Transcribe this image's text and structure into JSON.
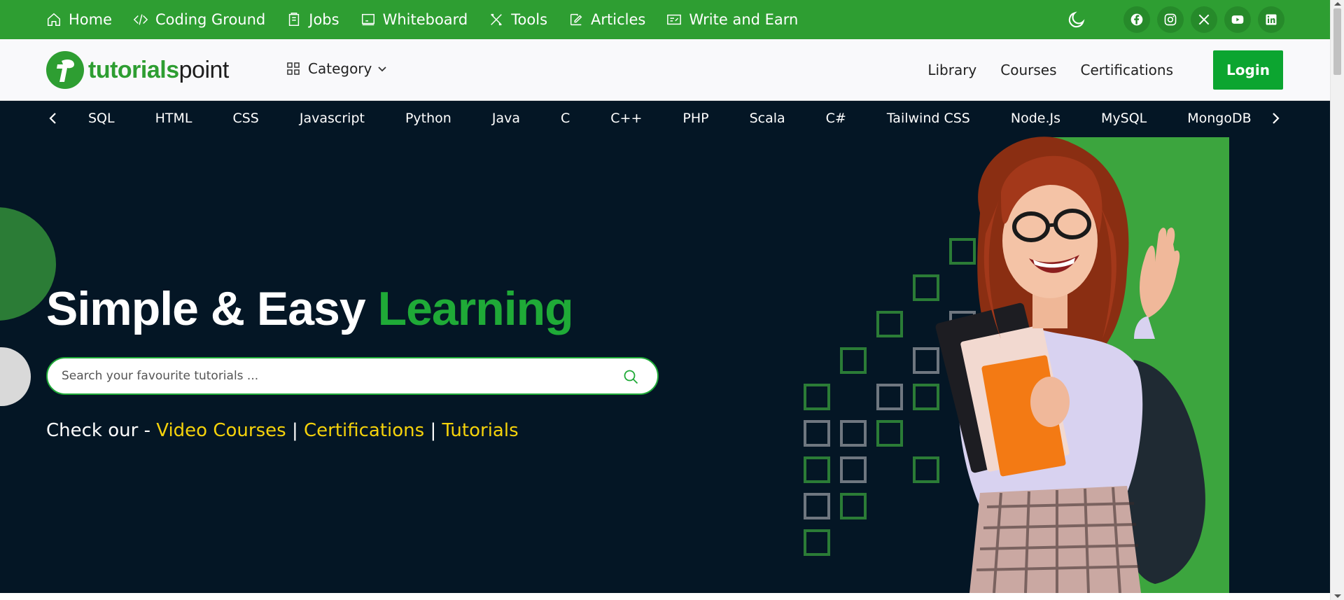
{
  "topnav": {
    "items": [
      {
        "label": "Home",
        "icon": "home-icon"
      },
      {
        "label": "Coding Ground",
        "icon": "code-icon"
      },
      {
        "label": "Jobs",
        "icon": "briefcase-icon"
      },
      {
        "label": "Whiteboard",
        "icon": "whiteboard-icon"
      },
      {
        "label": "Tools",
        "icon": "tools-icon"
      },
      {
        "label": "Articles",
        "icon": "edit-icon"
      },
      {
        "label": "Write and Earn",
        "icon": "write-earn-icon"
      }
    ],
    "socials": [
      "facebook-icon",
      "instagram-icon",
      "x-icon",
      "youtube-icon",
      "linkedin-icon"
    ]
  },
  "header": {
    "logo_part1": "tutorials",
    "logo_part2": "point",
    "category_label": "Category",
    "links": [
      "Library",
      "Courses",
      "Certifications"
    ],
    "login_label": "Login"
  },
  "techbar": {
    "items": [
      "SQL",
      "HTML",
      "CSS",
      "Javascript",
      "Python",
      "Java",
      "C",
      "C++",
      "PHP",
      "Scala",
      "C#",
      "Tailwind CSS",
      "Node.Js",
      "MySQL",
      "MongoDB"
    ]
  },
  "hero": {
    "title_white": "Simple & Easy",
    "title_green": "Learning",
    "search_placeholder": "Search your favourite tutorials ...",
    "check_prefix": "Check our -",
    "link_video": "Video Courses",
    "sep1": "|",
    "link_cert": "Certifications",
    "sep2": "|",
    "link_tut": "Tutorials"
  },
  "colors": {
    "brand_green": "#2e9e32",
    "login_green": "#0ca530",
    "dark_bg": "#041625",
    "accent_yellow": "#f5d20b"
  }
}
